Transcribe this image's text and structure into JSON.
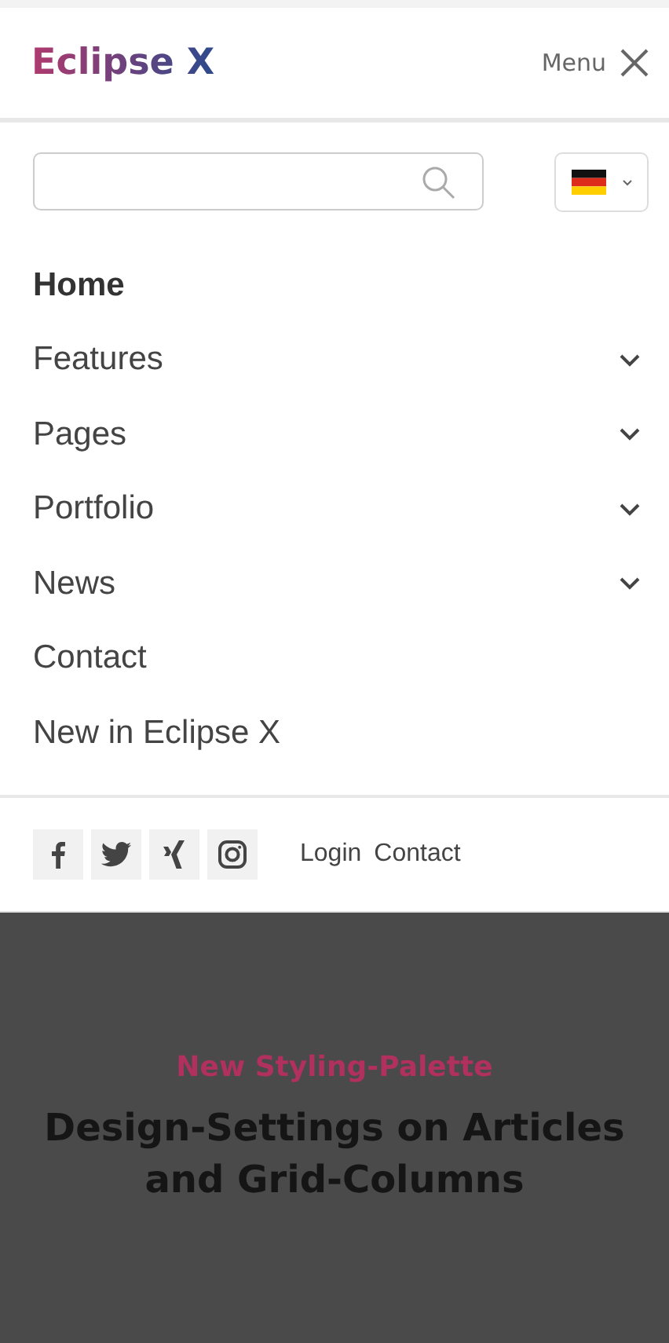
{
  "header": {
    "logo": "Eclipse X",
    "menu_label": "Menu"
  },
  "nav": [
    {
      "label": "Home",
      "selected": true,
      "has_submenu": false
    },
    {
      "label": "Features",
      "selected": false,
      "has_submenu": true
    },
    {
      "label": "Pages",
      "selected": false,
      "has_submenu": true
    },
    {
      "label": "Portfolio",
      "selected": false,
      "has_submenu": true
    },
    {
      "label": "News",
      "selected": false,
      "has_submenu": true
    },
    {
      "label": "Contact",
      "selected": false,
      "has_submenu": false
    },
    {
      "label": "New in Eclipse X",
      "selected": false,
      "has_submenu": false
    }
  ],
  "social": [
    {
      "kind": "facebook"
    },
    {
      "kind": "twitter"
    },
    {
      "kind": "xing"
    },
    {
      "kind": "instagram"
    }
  ],
  "footer_links": [
    "Login",
    "Contact"
  ],
  "hero": {
    "kicker": "New Styling-Palette",
    "headline": "Design-Settings on Articles and Grid-Columns"
  }
}
